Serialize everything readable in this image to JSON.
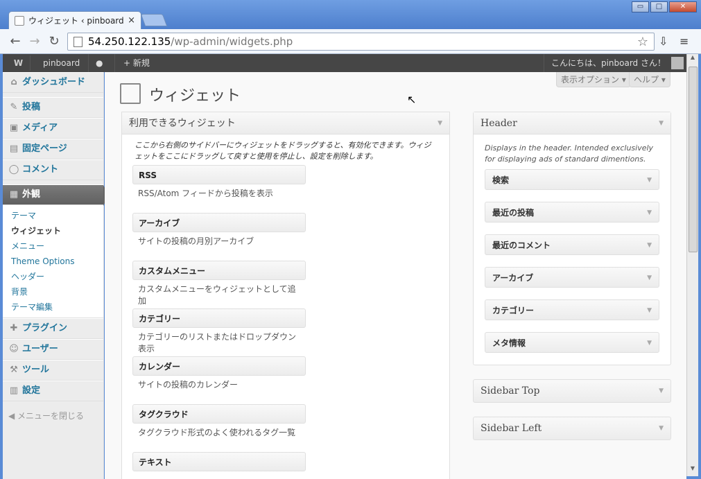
{
  "browser": {
    "tab_title": "ウィジェット ‹ pinboard",
    "tab_close": "×",
    "url_host": "54.250.122.135",
    "url_path": "/wp-admin/widgets.php",
    "win_min": "▭",
    "win_max": "□",
    "win_close": "✕"
  },
  "adminbar": {
    "site": "pinboard",
    "new": "新規",
    "greeting": "こんにちは、pinboard さん！"
  },
  "menu": {
    "dashboard": "ダッシュボード",
    "posts": "投稿",
    "media": "メディア",
    "pages": "固定ページ",
    "comments": "コメント",
    "appearance": "外観",
    "sub": [
      "テーマ",
      "ウィジェット",
      "メニュー",
      "Theme Options",
      "ヘッダー",
      "背景",
      "テーマ編集"
    ],
    "plugins": "プラグイン",
    "users": "ユーザー",
    "tools": "ツール",
    "settings": "設定",
    "collapse": "メニューを閉じる"
  },
  "header": {
    "screen_options": "表示オプション ▾",
    "help": "ヘルプ ▾",
    "title": "ウィジェット"
  },
  "available": {
    "title": "利用できるウィジェット",
    "desc": "ここから右側のサイドバーにウィジェットをドラッグすると、有効化できます。ウィジェットをここにドラッグして戻すと使用を停止し、設定を削除します。",
    "widgets": [
      {
        "title": "RSS",
        "desc": "RSS/Atom フィードから投稿を表示"
      },
      {
        "title": "アーカイブ",
        "desc": "サイトの投稿の月別アーカイブ"
      },
      {
        "title": "カスタムメニュー",
        "desc": "カスタムメニューをウィジェットとして追加"
      },
      {
        "title": "カテゴリー",
        "desc": "カテゴリーのリストまたはドロップダウン表示"
      },
      {
        "title": "カレンダー",
        "desc": "サイトの投稿のカレンダー"
      },
      {
        "title": "タグクラウド",
        "desc": "タグクラウド形式のよく使われるタグ一覧"
      },
      {
        "title": "テキスト",
        "desc": ""
      }
    ]
  },
  "header_sidebar": {
    "title": "Header",
    "desc": "Displays in the header. Intended exclusively for displaying ads of standard dimentions.",
    "widgets": [
      "検索",
      "最近の投稿",
      "最近のコメント",
      "アーカイブ",
      "カテゴリー",
      "メタ情報"
    ]
  },
  "other_sidebars": [
    "Sidebar Top",
    "Sidebar Left"
  ]
}
